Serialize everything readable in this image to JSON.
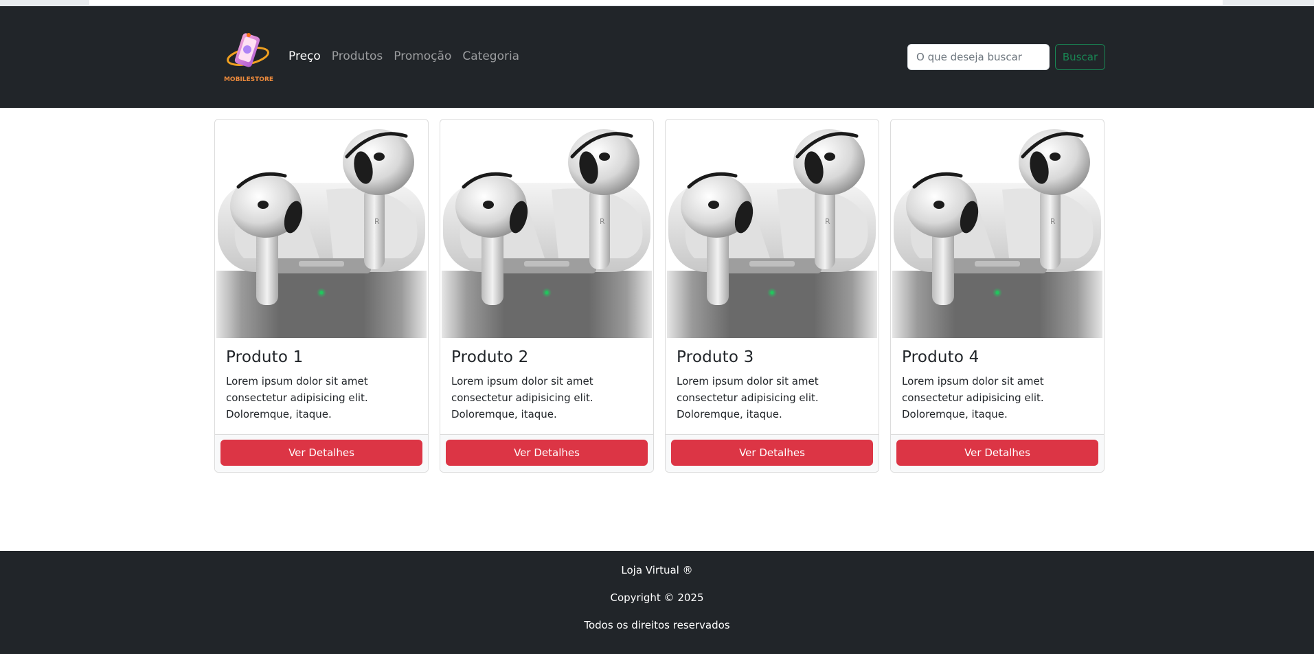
{
  "navbar": {
    "brand_name": "MOBILESTORE",
    "links": [
      {
        "label": "Preço",
        "active": true
      },
      {
        "label": "Produtos",
        "active": false
      },
      {
        "label": "Promoção",
        "active": false
      },
      {
        "label": "Categoria",
        "active": false
      }
    ],
    "search": {
      "placeholder": "O que deseja buscar",
      "value": ""
    },
    "search_button": "Buscar"
  },
  "products": [
    {
      "title": "Produto 1",
      "description": "Lorem ipsum dolor sit amet consectetur adipisicing elit. Doloremque, itaque.",
      "button": "Ver Detalhes"
    },
    {
      "title": "Produto 2",
      "description": "Lorem ipsum dolor sit amet consectetur adipisicing elit. Doloremque, itaque.",
      "button": "Ver Detalhes"
    },
    {
      "title": "Produto 3",
      "description": "Lorem ipsum dolor sit amet consectetur adipisicing elit. Doloremque, itaque.",
      "button": "Ver Detalhes"
    },
    {
      "title": "Produto 4",
      "description": "Lorem ipsum dolor sit amet consectetur adipisicing elit. Doloremque, itaque.",
      "button": "Ver Detalhes"
    }
  ],
  "footer": {
    "line1": "Loja Virtual ®",
    "line2": "Copyright © 2025",
    "line3": "Todos os direitos reservados"
  },
  "colors": {
    "navbar_bg": "#212529",
    "accent_green": "#198754",
    "button_red": "#dc3545",
    "led_green": "#22c55e"
  },
  "icons": {
    "logo": "mobile-phone-logo-icon",
    "product_image": "earbuds-product-image"
  }
}
